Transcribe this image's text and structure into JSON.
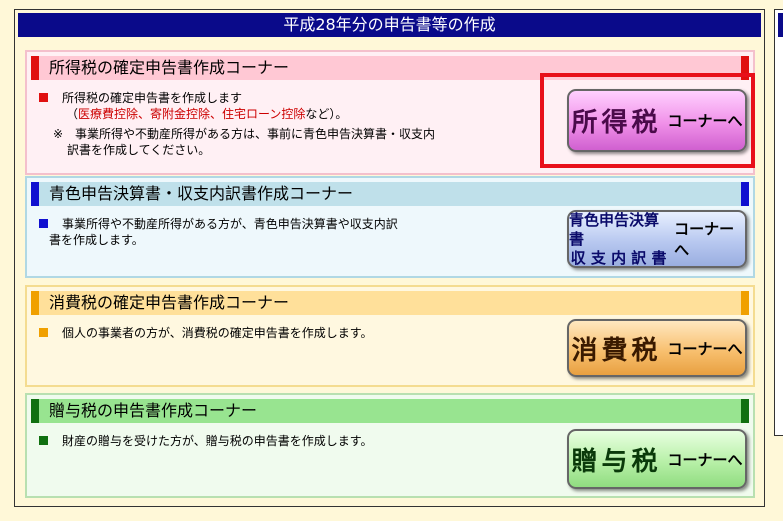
{
  "page": {
    "title": "平成28年分の申告書等の作成"
  },
  "sections": [
    {
      "title": "所得税の確定申告書作成コーナー",
      "desc_line1": "所得税の確定申告書を作成します",
      "desc_open": "（",
      "desc_links": "医療費控除、寄附金控除、住宅ローン控除",
      "desc_close": "など）。",
      "note_line1": "※　事業所得や不動産所得がある方は、事前に青色申告決算書・収支内",
      "note_line2": "訳書を作成してください。",
      "button_main": "所得税",
      "button_sub": "コーナーへ"
    },
    {
      "title": "青色申告決算書・収支内訳書作成コーナー",
      "desc_line1": "事業所得や不動産所得がある方が、青色申告決算書や収支内訳",
      "desc_line2": "書を作成します。",
      "button_line1": "青色申告決算書",
      "button_line2": "収 支 内 訳 書",
      "button_sub": "コーナーへ"
    },
    {
      "title": "消費税の確定申告書作成コーナー",
      "desc_line1": "個人の事業者の方が、消費税の確定申告書を作成します。",
      "button_main": "消費税",
      "button_sub": "コーナーへ"
    },
    {
      "title": "贈与税の申告書作成コーナー",
      "desc_line1": "財産の贈与を受けた方が、贈与税の申告書を作成します。",
      "button_main": "贈与税",
      "button_sub": "コーナーへ"
    }
  ],
  "colors": {
    "title_bar": "#0a0a8a",
    "income": "#e01010",
    "blue": "#1010d0",
    "consumption": "#f0a000",
    "gift": "#107010",
    "highlight": "#e8101a"
  }
}
